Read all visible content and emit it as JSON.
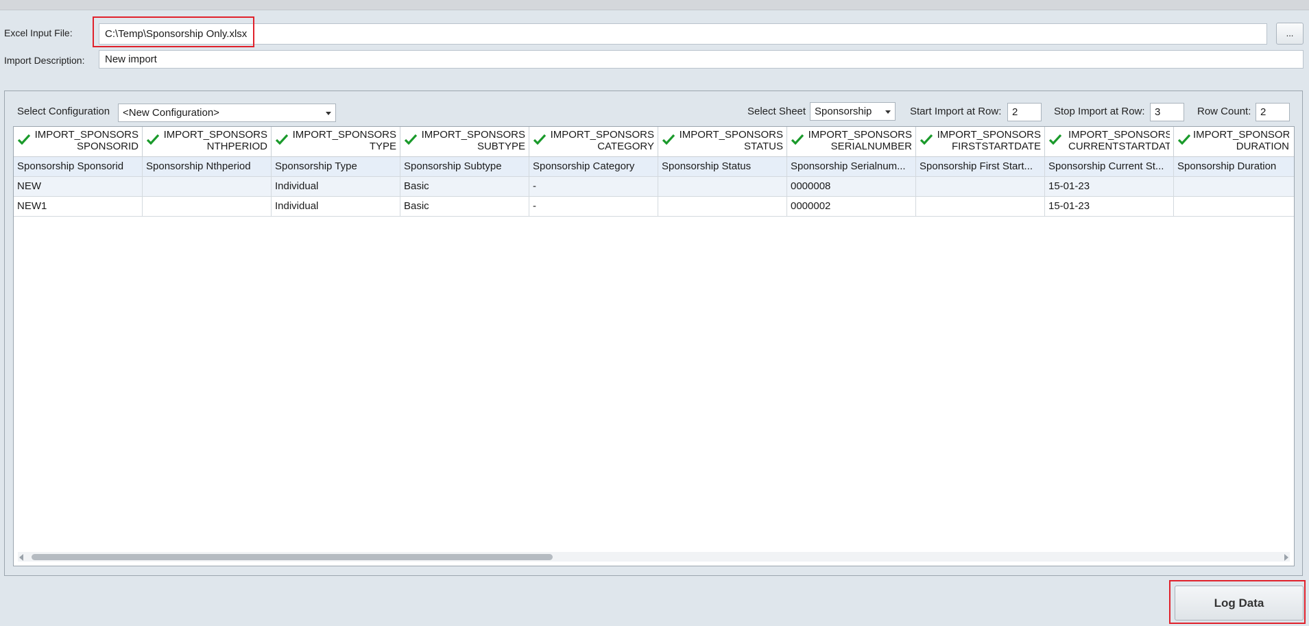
{
  "file": {
    "label": "Excel Input File:",
    "value": "C:\\Temp\\Sponsorship Only.xlsx",
    "browse_label": "..."
  },
  "description": {
    "label": "Import Description:",
    "value": "New import"
  },
  "toolbar": {
    "config_label": "Select Configuration",
    "config_value": "<New Configuration>",
    "sheet_label": "Select Sheet",
    "sheet_value": "Sponsorship",
    "start_label": "Start Import at Row:",
    "start_value": "2",
    "stop_label": "Stop Import at Row:",
    "stop_value": "3",
    "count_label": "Row Count:",
    "count_value": "2"
  },
  "grid": {
    "columns": [
      {
        "l1": "IMPORT_SPONSORS",
        "l2": "SPONSORID",
        "map": "Sponsorship Sponsorid"
      },
      {
        "l1": "IMPORT_SPONSORS",
        "l2": "NTHPERIOD",
        "map": "Sponsorship Nthperiod"
      },
      {
        "l1": "IMPORT_SPONSORS",
        "l2": "TYPE",
        "map": "Sponsorship Type"
      },
      {
        "l1": "IMPORT_SPONSORS",
        "l2": "SUBTYPE",
        "map": "Sponsorship Subtype"
      },
      {
        "l1": "IMPORT_SPONSORS",
        "l2": "CATEGORY",
        "map": "Sponsorship Category"
      },
      {
        "l1": "IMPORT_SPONSORS",
        "l2": "STATUS",
        "map": "Sponsorship Status"
      },
      {
        "l1": "IMPORT_SPONSORS",
        "l2": "SERIALNUMBER",
        "map": "Sponsorship Serialnum..."
      },
      {
        "l1": "IMPORT_SPONSORS",
        "l2": "FIRSTSTARTDATE",
        "map": "Sponsorship First Start..."
      },
      {
        "l1": "IMPORT_SPONSORS",
        "l2": "CURRENTSTARTDAT",
        "map": "Sponsorship Current St..."
      },
      {
        "l1": "IMPORT_SPONSOR",
        "l2": "DURATION",
        "map": "Sponsorship Duration"
      }
    ],
    "rows": [
      [
        "NEW",
        "",
        "Individual",
        "Basic",
        "-",
        "",
        "0000008",
        "",
        "15-01-23",
        ""
      ],
      [
        "NEW1",
        "",
        "Individual",
        "Basic",
        "-",
        "",
        "0000002",
        "",
        "15-01-23",
        ""
      ]
    ]
  },
  "actions": {
    "log_data_label": "Log Data"
  },
  "colors": {
    "check": "#1a9a2b",
    "highlight": "#e0212b"
  }
}
